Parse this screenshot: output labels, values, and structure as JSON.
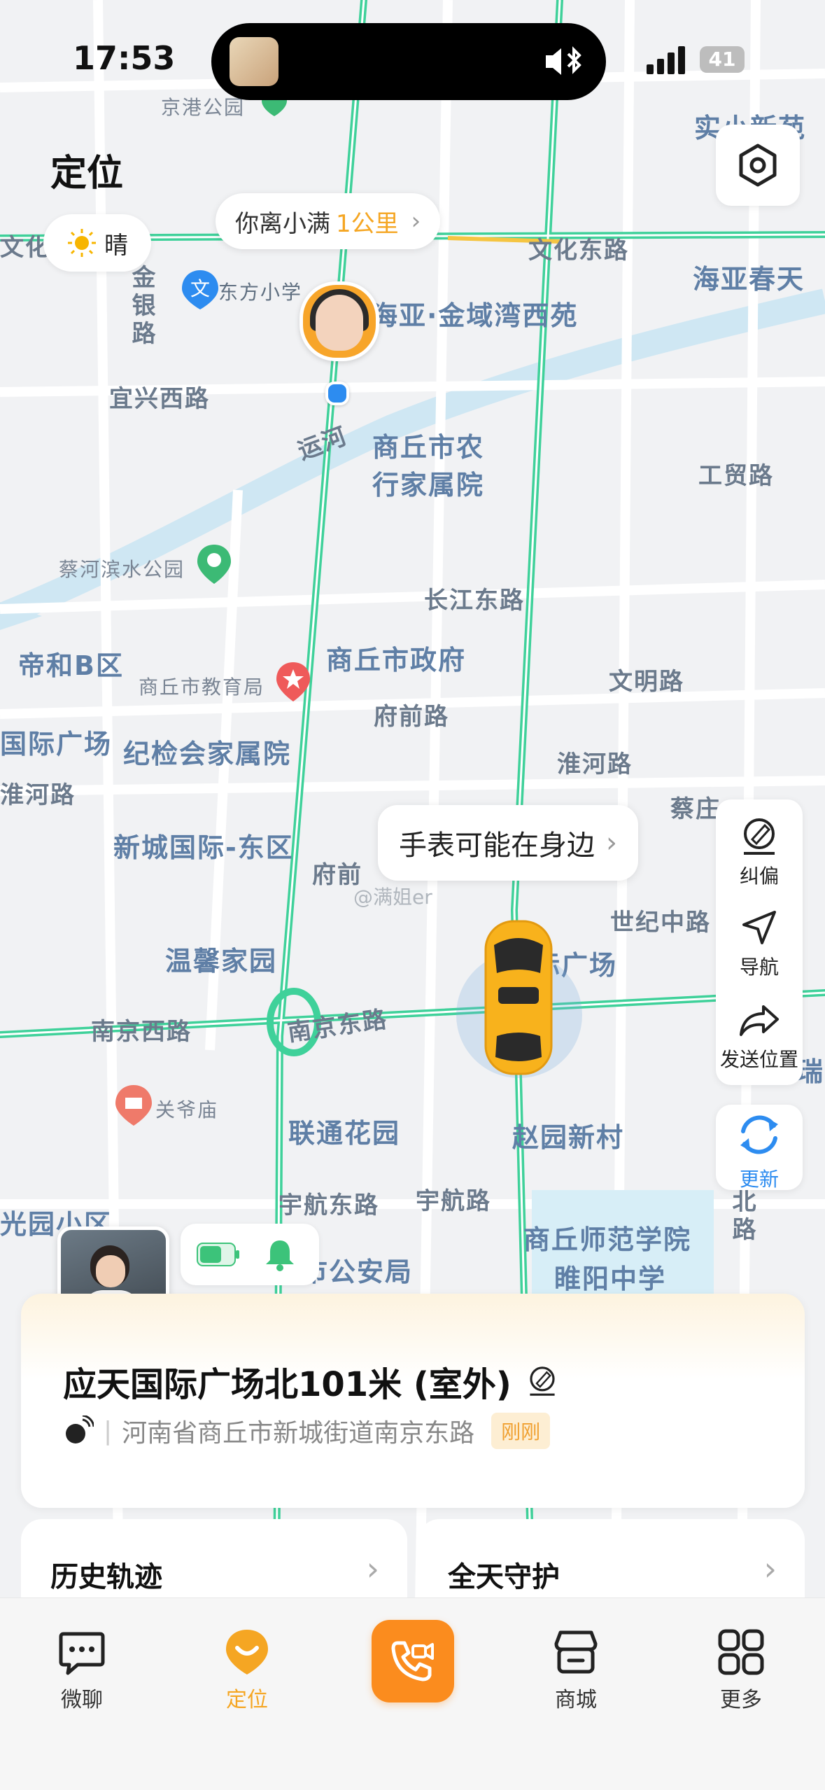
{
  "status_bar": {
    "time": "17:53",
    "battery": "41"
  },
  "header": {
    "title": "定位"
  },
  "weather": {
    "text": "晴"
  },
  "distance_bubble": {
    "prefix": "你离小满",
    "distance": "1公里",
    "chevron": "›"
  },
  "watch_bubble": {
    "text": "手表可能在身边",
    "chevron": "›"
  },
  "map": {
    "roads": [
      "文化东路",
      "文化中",
      "金银路",
      "宜兴西路",
      "运河",
      "长江东路",
      "府前路",
      "淮河路",
      "世纪中路",
      "南京西路",
      "南京东路",
      "宇航东路",
      "宇航路",
      "工贸路",
      "文明路",
      "北路",
      "院",
      "路",
      "淮河路",
      "府前"
    ],
    "pois": [
      "京港公园",
      "东方小学",
      "海亚·金域湾西苑",
      "海亚春天",
      "实小新苑",
      "商丘市农行家属院",
      "蔡河滨水公园",
      "帝和B区",
      "商丘市政府",
      "商丘市教育局",
      "纪检会家属院",
      "新城国际-东区",
      "温馨家园",
      "关爷庙",
      "联通花园",
      "赵园新村",
      "商丘师范学院",
      "睢阳中学",
      "市公安局",
      "光园小区",
      "国际广场",
      "蔡庄",
      "庙",
      "瑞"
    ],
    "watermark": "@满姐er"
  },
  "side_tools": [
    {
      "label": "纠偏",
      "icon": "correction-icon"
    },
    {
      "label": "导航",
      "icon": "navigation-icon"
    },
    {
      "label": "发送位置",
      "icon": "share-icon"
    }
  ],
  "refresh": {
    "label": "更新"
  },
  "location_card": {
    "title": "应天国际广场北101米 (室外)",
    "address": "河南省商丘市新城街道南京东路",
    "badge": "刚刚"
  },
  "cards": [
    {
      "title": "历史轨迹",
      "chevron": "›"
    },
    {
      "title": "全天守护",
      "chevron": "›"
    }
  ],
  "tabs": [
    {
      "label": "微聊",
      "active": false
    },
    {
      "label": "定位",
      "active": true
    },
    {
      "label": "商城",
      "active": false
    },
    {
      "label": "更多",
      "active": false
    }
  ],
  "colors": {
    "accent": "#f5a623",
    "road_green": "#3fd19a",
    "blue": "#2d8cf0",
    "call": "#fb8c1e"
  }
}
